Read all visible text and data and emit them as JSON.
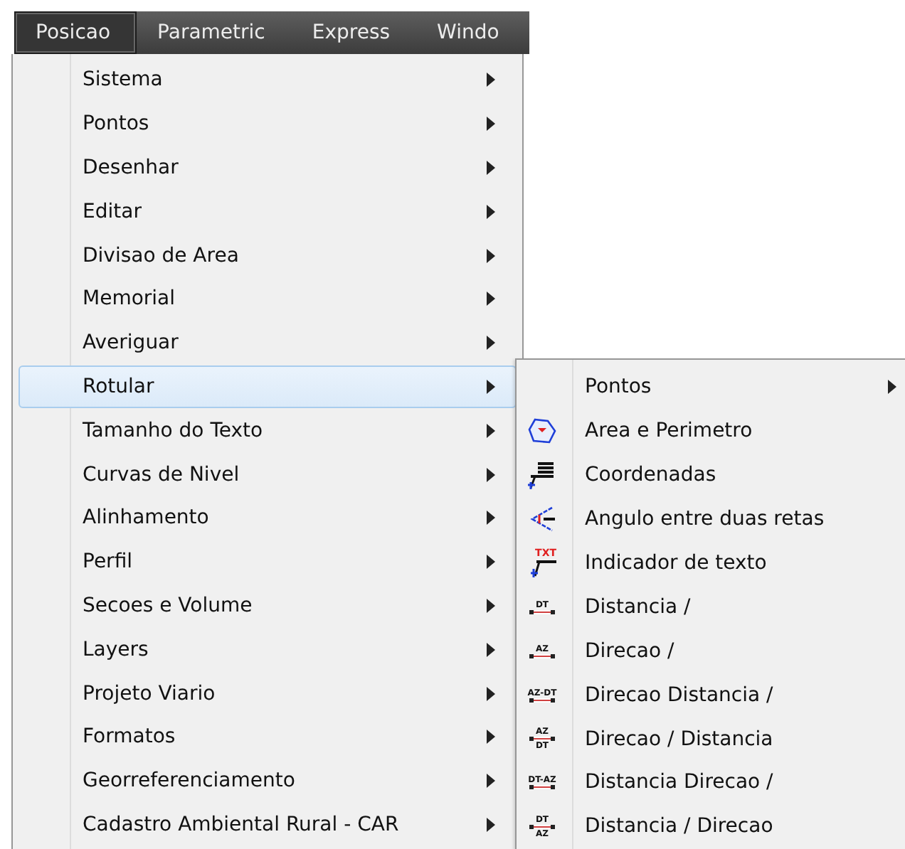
{
  "menu_bar": [
    {
      "label": "Posicao",
      "selected": true
    },
    {
      "label": "Parametric",
      "selected": false
    },
    {
      "label": "Express",
      "selected": false
    },
    {
      "label": "Windo",
      "selected": false
    }
  ],
  "menu": {
    "items": [
      {
        "label": "Sistema",
        "selected": false,
        "submenu": true
      },
      {
        "label": "Pontos",
        "selected": false,
        "submenu": true
      },
      {
        "label": "Desenhar",
        "selected": false,
        "submenu": true
      },
      {
        "label": "Editar",
        "selected": false,
        "submenu": true
      },
      {
        "label": "Divisao de Area",
        "selected": false,
        "submenu": true
      },
      {
        "label": "Memorial",
        "selected": false,
        "submenu": true
      },
      {
        "label": "Averiguar",
        "selected": false,
        "submenu": true
      },
      {
        "label": "Rotular",
        "selected": true,
        "submenu": true
      },
      {
        "label": "Tamanho do Texto",
        "selected": false,
        "submenu": true
      },
      {
        "label": "Curvas de Nivel",
        "selected": false,
        "submenu": true
      },
      {
        "label": "Alinhamento",
        "selected": false,
        "submenu": true
      },
      {
        "label": "Perfil",
        "selected": false,
        "submenu": true
      },
      {
        "label": "Secoes e Volume",
        "selected": false,
        "submenu": true
      },
      {
        "label": "Layers",
        "selected": false,
        "submenu": true
      },
      {
        "label": "Projeto Viario",
        "selected": false,
        "submenu": true
      },
      {
        "label": "Formatos",
        "selected": false,
        "submenu": true
      },
      {
        "label": "Georreferenciamento",
        "selected": false,
        "submenu": true
      },
      {
        "label": "Cadastro Ambiental Rural - CAR",
        "selected": false,
        "submenu": true
      }
    ]
  },
  "submenu": {
    "items": [
      {
        "label": "Pontos",
        "kind": "submenu"
      },
      {
        "label": "Area e Perimetro",
        "kind": "area"
      },
      {
        "label": "Coordenadas",
        "kind": "coords"
      },
      {
        "label": "Angulo entre duas retas",
        "kind": "angle"
      },
      {
        "label": "Indicador de texto",
        "kind": "text-leader",
        "icon_text": [
          "TXT"
        ]
      },
      {
        "label": "Distancia /",
        "kind": "measure",
        "icon_text": [
          "DT"
        ]
      },
      {
        "label": "Direcao /",
        "kind": "measure",
        "icon_text": [
          "AZ"
        ]
      },
      {
        "label": "Direcao Distancia /",
        "kind": "measure",
        "icon_text": [
          "AZ-DT"
        ]
      },
      {
        "label": "Direcao / Distancia",
        "kind": "measure",
        "icon_text": [
          "AZ",
          "DT"
        ]
      },
      {
        "label": "Distancia Direcao /",
        "kind": "measure",
        "icon_text": [
          "DT-AZ"
        ]
      },
      {
        "label": "Distancia / Direcao",
        "kind": "measure",
        "icon_text": [
          "DT",
          "AZ"
        ]
      }
    ]
  }
}
